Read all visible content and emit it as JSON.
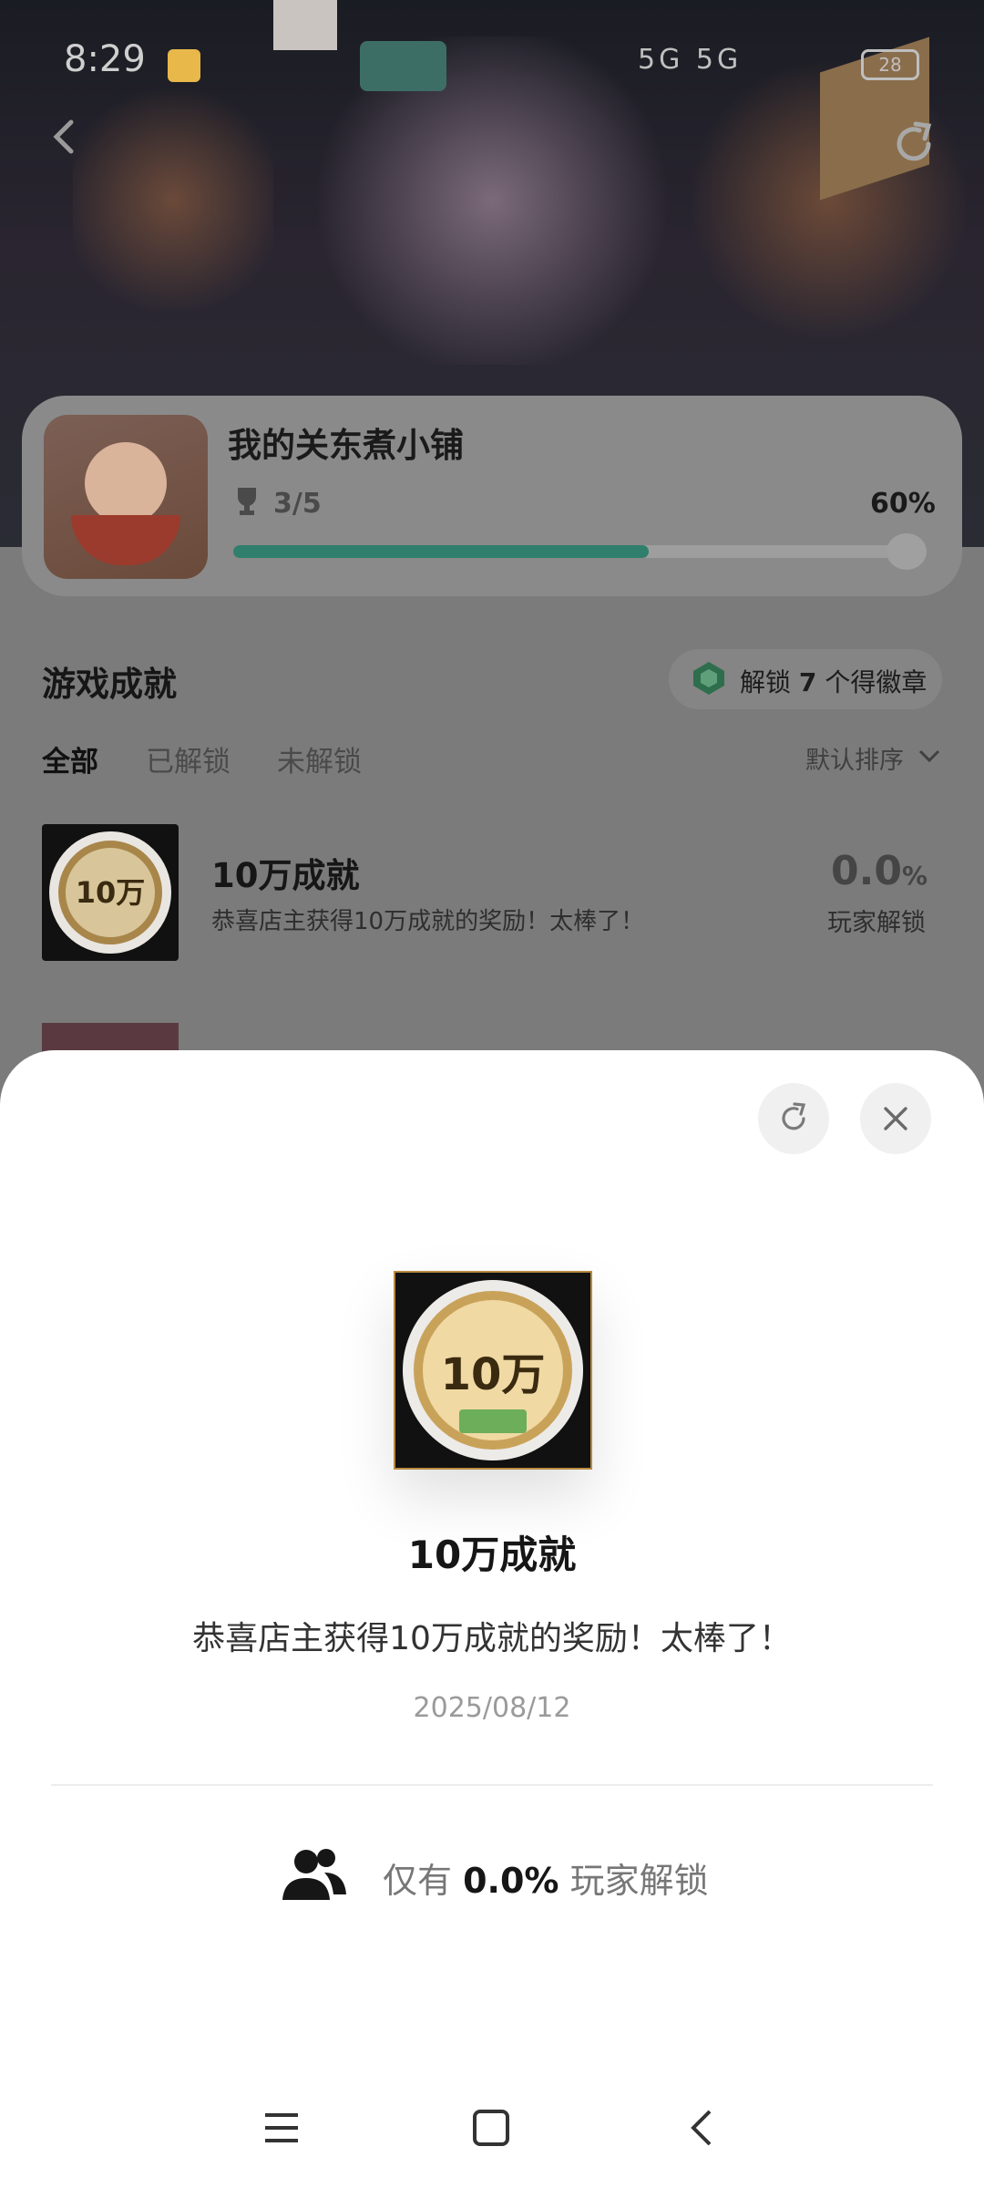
{
  "status_bar": {
    "time": "8:29",
    "network": "5G 5G",
    "battery": "28"
  },
  "shop": {
    "title": "我的关东煮小铺",
    "progress_text": "3/5",
    "progress_percent_label": "60%",
    "progress_value": 0.6
  },
  "achievements": {
    "section_title": "游戏成就",
    "badge_prefix": "解锁",
    "badge_count": "7",
    "badge_suffix": "个得徽章",
    "tabs": [
      {
        "label": "全部",
        "active": true
      },
      {
        "label": "已解锁",
        "active": false
      },
      {
        "label": "未解锁",
        "active": false
      }
    ],
    "sort_label": "默认排序",
    "items": [
      {
        "name": "10万成就",
        "description": "恭喜店主获得10万成就的奖励！太棒了！",
        "percent": "0.0",
        "percent_unit": "%",
        "percent_label": "玩家解锁",
        "thumb_text": "10万"
      }
    ]
  },
  "sheet": {
    "badge_text": "10万",
    "title": "10万成就",
    "description": "恭喜店主获得10万成就的奖励！太棒了！",
    "date": "2025/08/12",
    "unlock_prefix": "仅有",
    "unlock_percent": "0.0%",
    "unlock_suffix": "玩家解锁"
  },
  "colors": {
    "progress_fill": "#2f7f6c",
    "accent_gold": "#b98a3f",
    "sheet_bg": "#ffffff"
  },
  "icons": [
    "back-icon",
    "share-icon",
    "trophy-icon",
    "badge-icon",
    "chevron-down-icon",
    "close-icon",
    "people-icon",
    "menu-icon",
    "home-icon",
    "nav-back-icon"
  ]
}
